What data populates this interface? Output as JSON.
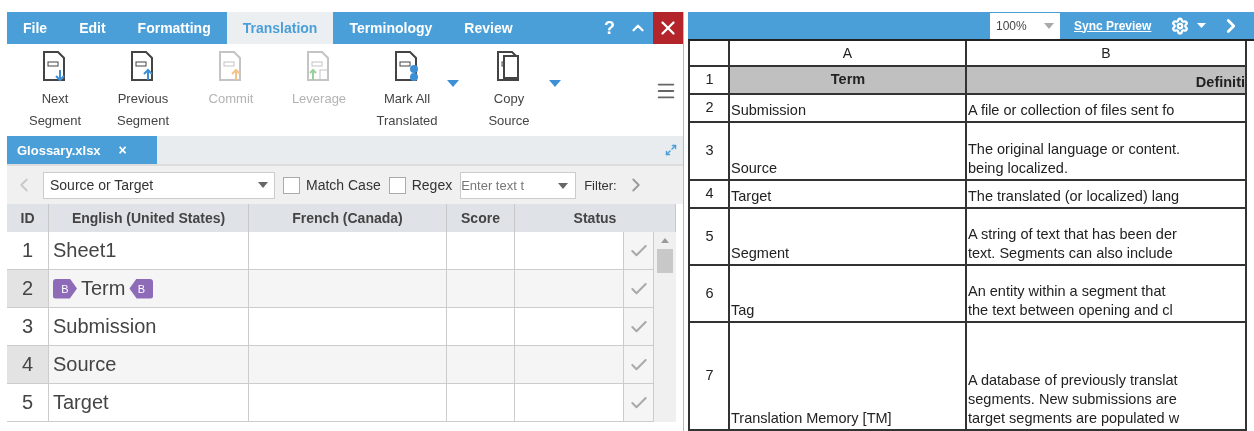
{
  "menu": {
    "tabs": [
      {
        "label": "File",
        "selected": false
      },
      {
        "label": "Edit",
        "selected": false
      },
      {
        "label": "Formatting",
        "selected": false
      },
      {
        "label": "Translation",
        "selected": true
      },
      {
        "label": "Terminology",
        "selected": false
      },
      {
        "label": "Review",
        "selected": false
      }
    ],
    "help": "?"
  },
  "ribbon": [
    {
      "kind": "next",
      "label": [
        "Next",
        "Segment"
      ],
      "disabled": false,
      "dropdown": false
    },
    {
      "kind": "previous",
      "label": [
        "Previous",
        "Segment"
      ],
      "disabled": false,
      "dropdown": false
    },
    {
      "kind": "commit",
      "label": [
        "Commit"
      ],
      "disabled": true,
      "dropdown": false
    },
    {
      "kind": "leverage",
      "label": [
        "Leverage"
      ],
      "disabled": true,
      "dropdown": false
    },
    {
      "kind": "mark",
      "label": [
        "Mark All",
        "Translated"
      ],
      "disabled": false,
      "dropdown": true
    },
    {
      "kind": "copy",
      "label": [
        "Copy",
        "Source"
      ],
      "disabled": false,
      "dropdown": true
    }
  ],
  "document_tab": {
    "label": "Glossary.xlsx",
    "close": "×"
  },
  "filter_bar": {
    "scope": "Source or Target",
    "match_case": {
      "label": "Match Case",
      "checked": false
    },
    "regex": {
      "label": "Regex",
      "checked": false
    },
    "search": {
      "placeholder": "Enter text t"
    },
    "filter_label": "Filter:"
  },
  "segments": {
    "columns": [
      "ID",
      "English (United States)",
      "French (Canada)",
      "Score",
      "Status"
    ],
    "rows": [
      {
        "id": "1",
        "source": "Sheet1",
        "open_tag": null,
        "close_tag": null
      },
      {
        "id": "2",
        "source": "Term",
        "open_tag": "B",
        "close_tag": "B"
      },
      {
        "id": "3",
        "source": "Submission",
        "open_tag": null,
        "close_tag": null
      },
      {
        "id": "4",
        "source": "Source",
        "open_tag": null,
        "close_tag": null
      },
      {
        "id": "5",
        "source": "Target",
        "open_tag": null,
        "close_tag": null
      }
    ]
  },
  "preview": {
    "zoom": "100%",
    "sync": "Sync Preview",
    "columns": [
      "A",
      "B"
    ],
    "rows": [
      {
        "num": "1",
        "a": "Term",
        "b": [
          "Definiti"
        ],
        "header": true
      },
      {
        "num": "2",
        "a": "Submission",
        "b": [
          "A file or collection of files sent fo"
        ],
        "header": false
      },
      {
        "num": "3",
        "a": "Source",
        "b": [
          "The original language or content.",
          "being localized."
        ],
        "header": false
      },
      {
        "num": "4",
        "a": "Target",
        "b": [
          "The translated (or localized) lang"
        ],
        "header": false
      },
      {
        "num": "5",
        "a": "Segment",
        "b": [
          "A string of text that has been der",
          "text.  Segments can also include"
        ],
        "header": false
      },
      {
        "num": "6",
        "a": "Tag",
        "b": [
          "An entity within a segment that",
          "the text between opening and cl"
        ],
        "header": false
      },
      {
        "num": "7",
        "a": "Translation Memory [TM]",
        "b": [
          "A database of previously translat",
          "segments. New submissions are",
          "target segments are populated w"
        ],
        "header": false
      }
    ]
  }
}
